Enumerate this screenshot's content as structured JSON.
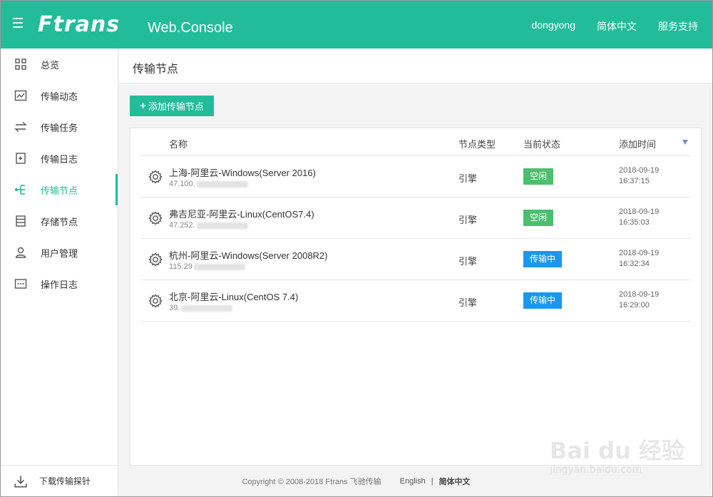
{
  "header": {
    "logo": "Ftrans",
    "logo_sub": "Web.Console",
    "user": "dongyong",
    "language": "简体中文",
    "support": "服务支持"
  },
  "sidebar": {
    "items": [
      {
        "label": "总览",
        "icon": "grid-icon"
      },
      {
        "label": "传输动态",
        "icon": "chart-icon"
      },
      {
        "label": "传输任务",
        "icon": "transfer-icon"
      },
      {
        "label": "传输日志",
        "icon": "log-icon"
      },
      {
        "label": "传输节点",
        "icon": "node-icon"
      },
      {
        "label": "存储节点",
        "icon": "storage-icon"
      },
      {
        "label": "用户管理",
        "icon": "user-icon"
      },
      {
        "label": "操作日志",
        "icon": "oplog-icon"
      }
    ],
    "active_index": 4,
    "bottom_label": "下载传输探针"
  },
  "page": {
    "title": "传输节点",
    "add_button": "添加传输节点"
  },
  "table": {
    "columns": {
      "name": "名称",
      "type": "节点类型",
      "status": "当前状态",
      "time": "添加时间"
    },
    "rows": [
      {
        "name": "上海-阿里云-Windows(Server 2016)",
        "ip": "47.100.",
        "type": "引擎",
        "status": "空闲",
        "status_color": "#4cbf6e",
        "date": "2018-09-19",
        "time": "16:37:15"
      },
      {
        "name": "弗吉尼亚-阿里云-Linux(CentOS7.4)",
        "ip": "47.252.",
        "type": "引擎",
        "status": "空闲",
        "status_color": "#4cbf6e",
        "date": "2018-09-19",
        "time": "16:35:03"
      },
      {
        "name": "杭州-阿里云-Windows(Server 2008R2)",
        "ip": "115.29",
        "type": "引擎",
        "status": "传输中",
        "status_color": "#1a98ee",
        "date": "2018-09-19",
        "time": "16:32:34"
      },
      {
        "name": "北京-阿里云-Linux(CentOS 7.4)",
        "ip": "39.",
        "type": "引擎",
        "status": "传输中",
        "status_color": "#1a98ee",
        "date": "2018-09-19",
        "time": "16:29:00"
      }
    ]
  },
  "footer": {
    "copyright": "Copyright © 2008-2018 Ftrans 飞驰传输",
    "english": "English",
    "chinese": "简体中文"
  },
  "watermark": {
    "text": "Bai du 经验",
    "sub": "jingyan.baidu.com"
  },
  "colors": {
    "brand": "#23bc9b",
    "idle": "#4cbf6e",
    "transferring": "#1a98ee"
  }
}
